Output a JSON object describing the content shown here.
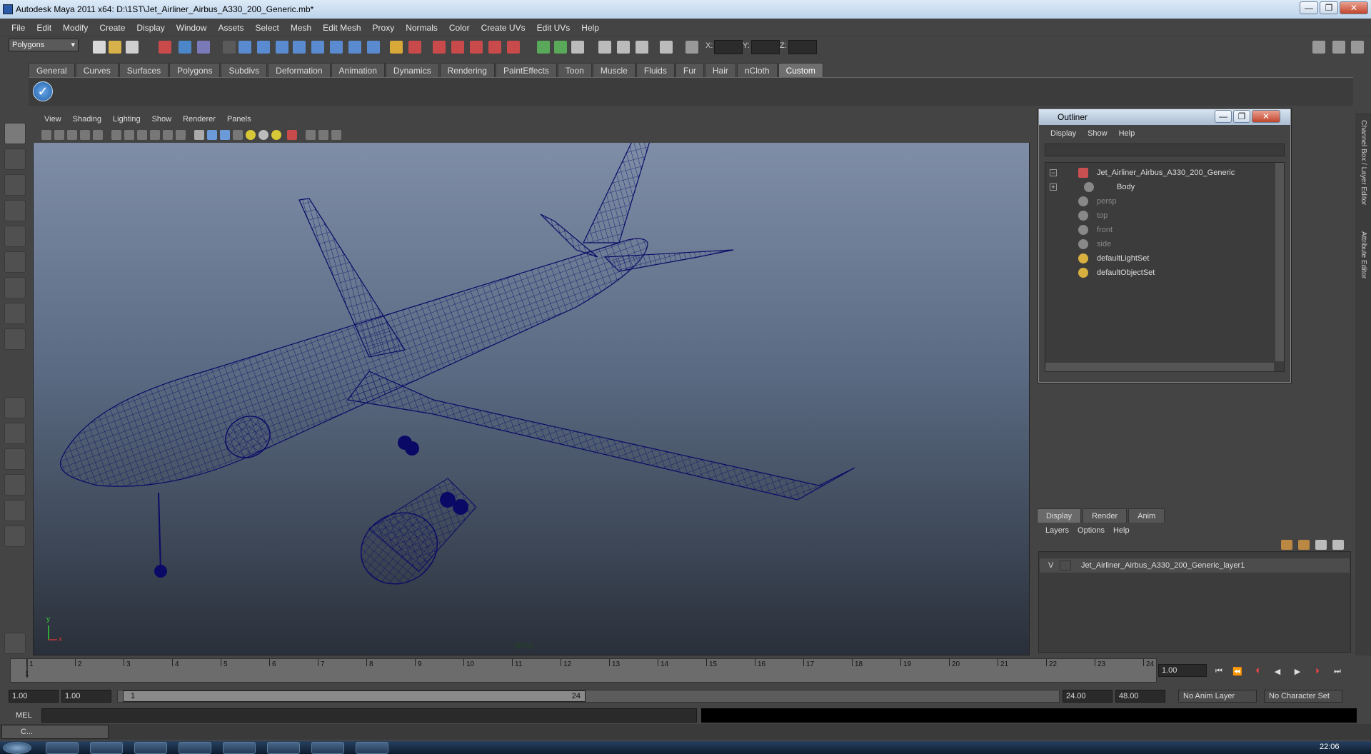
{
  "window": {
    "title": "Autodesk Maya 2011 x64: D:\\1ST\\Jet_Airliner_Airbus_A330_200_Generic.mb*",
    "min": "—",
    "max": "❐",
    "close": "✕"
  },
  "menu": [
    "File",
    "Edit",
    "Modify",
    "Create",
    "Display",
    "Window",
    "Assets",
    "Select",
    "Mesh",
    "Edit Mesh",
    "Proxy",
    "Normals",
    "Color",
    "Create UVs",
    "Edit UVs",
    "Help"
  ],
  "status": {
    "mode": "Polygons",
    "x_label": "X:",
    "y_label": "Y:",
    "z_label": "Z:"
  },
  "shelf_tabs": [
    "General",
    "Curves",
    "Surfaces",
    "Polygons",
    "Subdivs",
    "Deformation",
    "Animation",
    "Dynamics",
    "Rendering",
    "PaintEffects",
    "Toon",
    "Muscle",
    "Fluids",
    "Fur",
    "Hair",
    "nCloth",
    "Custom"
  ],
  "shelf_active": "Custom",
  "viewport": {
    "menu": [
      "View",
      "Shading",
      "Lighting",
      "Show",
      "Renderer",
      "Panels"
    ],
    "camera": "persp",
    "axis_x": "x",
    "axis_y": "y"
  },
  "outliner": {
    "title": "Outliner",
    "menu": [
      "Display",
      "Show",
      "Help"
    ],
    "items": [
      {
        "label": "Jet_Airliner_Airbus_A330_200_Generic",
        "dim": false,
        "expander": "−"
      },
      {
        "label": "Body",
        "dim": false,
        "expander": "+"
      },
      {
        "label": "persp",
        "dim": true
      },
      {
        "label": "top",
        "dim": true
      },
      {
        "label": "front",
        "dim": true
      },
      {
        "label": "side",
        "dim": true
      },
      {
        "label": "defaultLightSet",
        "dim": false
      },
      {
        "label": "defaultObjectSet",
        "dim": false
      }
    ]
  },
  "layer_editor": {
    "tabs": [
      "Display",
      "Render",
      "Anim"
    ],
    "menu": [
      "Layers",
      "Options",
      "Help"
    ],
    "layer": {
      "visible": "V",
      "name": "Jet_Airliner_Airbus_A330_200_Generic_layer1"
    }
  },
  "side_tabs": [
    "Channel Box / Layer Editor",
    "Attribute Editor"
  ],
  "timeline": {
    "ticks": [
      "1",
      "2",
      "3",
      "4",
      "5",
      "6",
      "7",
      "8",
      "9",
      "10",
      "11",
      "12",
      "13",
      "14",
      "15",
      "16",
      "17",
      "18",
      "19",
      "20",
      "21",
      "22",
      "23",
      "24"
    ],
    "current_frame": "1.00",
    "current_marker": "1"
  },
  "range": {
    "start": "1.00",
    "anim_start": "1.00",
    "handle_start": "1",
    "handle_end": "24",
    "end": "24.00",
    "anim_end": "48.00",
    "anim_layer": "No Anim Layer",
    "char_set": "No Character Set"
  },
  "cmd": {
    "label": "MEL"
  },
  "minimized": {
    "label": "C..."
  },
  "clock": "22:06",
  "colors": {
    "wire": "#0a0a66",
    "bg_top": "#7f8ea6",
    "bg_bottom": "#2a303a"
  }
}
